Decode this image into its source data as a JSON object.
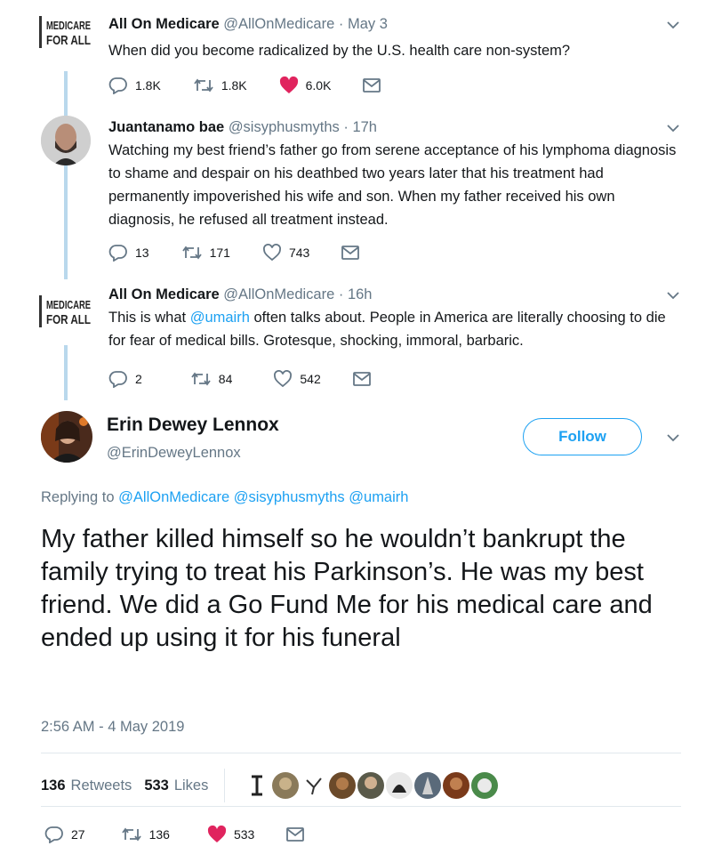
{
  "tweets": [
    {
      "name": "All On Medicare",
      "handle": "@AllOnMedicare",
      "dot": "·",
      "time": "May 3",
      "text": "When did you become radicalized by the U.S. health care non-system?",
      "replies": "1.8K",
      "retweets": "1.8K",
      "likes": "6.0K",
      "avatar_logo": [
        "MEDICARE",
        "FOR ALL"
      ]
    },
    {
      "name": "Juantanamo bae",
      "handle": "@sisyphusmyths",
      "dot": "·",
      "time": "17h",
      "text": "Watching my best friend’s father go from serene acceptance of his lymphoma diagnosis to shame and despair on his deathbed two years later that his treatment had permanently impoverished his wife and son. When my father received his own diagnosis, he refused all treatment instead.",
      "replies": "13",
      "retweets": "171",
      "likes": "743"
    },
    {
      "name": "All On Medicare",
      "handle": "@AllOnMedicare",
      "dot": "·",
      "time": "16h",
      "text_before": "This is what ",
      "mention": "@umairh",
      "text_after": " often talks about. People in America are literally choosing to die for fear of medical bills. Grotesque, shocking, immoral, barbaric.",
      "replies": "2",
      "retweets": "84",
      "likes": "542",
      "avatar_logo": [
        "MEDICARE",
        "FOR ALL"
      ]
    }
  ],
  "main": {
    "name": "Erin Dewey Lennox",
    "handle": "@ErinDeweyLennox",
    "follow_label": "Follow",
    "replying_prefix": "Replying to",
    "replying_to": [
      "@AllOnMedicare",
      "@sisyphusmyths",
      "@umairh"
    ],
    "text": "My father killed himself so he wouldn’t bankrupt the family trying to treat his Parkinson’s. He was my best friend. We did a Go Fund Me for his medical care and ended up using it for his funeral",
    "timestamp": "2:56 AM - 4 May 2019",
    "retweets_count": "136",
    "retweets_label": "Retweets",
    "likes_count": "533",
    "likes_label": "Likes",
    "replies": "27",
    "retweets": "136",
    "likes": "533"
  },
  "colors": {
    "accent": "#1da1f2",
    "like_red": "#e0245e",
    "thread_line": "#b9d8ec",
    "muted": "#657786",
    "retweet_icon": "#657786"
  },
  "icons": [
    "reply-icon",
    "retweet-icon",
    "heart-icon",
    "mail-icon",
    "chevron-down-icon"
  ]
}
